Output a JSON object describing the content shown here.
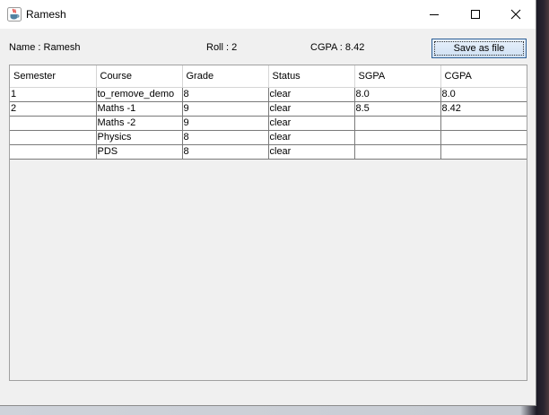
{
  "window": {
    "title": "Ramesh",
    "icon": "java-cup-icon"
  },
  "student": {
    "name_text": "Name : Ramesh",
    "roll_text": "Roll : 2",
    "cgpa_text": "CGPA : 8.42"
  },
  "actions": {
    "save_label": "Save as file"
  },
  "table": {
    "columns": [
      "Semester",
      "Course",
      "Grade",
      "Status",
      "SGPA",
      "CGPA"
    ],
    "rows": [
      [
        "1",
        "to_remove_demo",
        "8",
        "clear",
        "8.0",
        "8.0"
      ],
      [
        "2",
        "Maths -1",
        "9",
        "clear",
        "8.5",
        "8.42"
      ],
      [
        "",
        "Maths -2",
        "9",
        "clear",
        "",
        ""
      ],
      [
        "",
        "Physics",
        "8",
        "clear",
        "",
        ""
      ],
      [
        "",
        "PDS",
        "8",
        "clear",
        "",
        ""
      ]
    ]
  }
}
